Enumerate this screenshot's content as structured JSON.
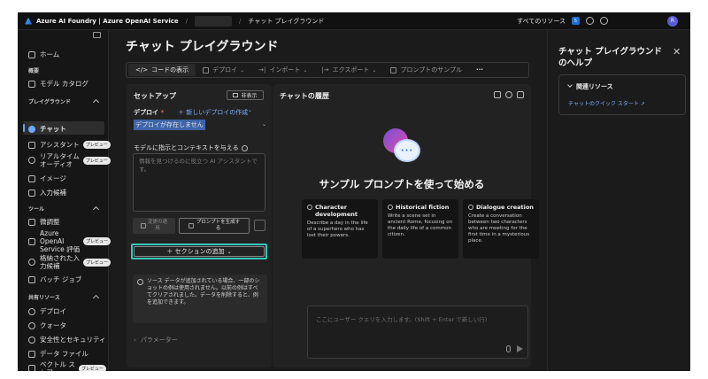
{
  "topbar": {
    "brand": "Azure AI Foundry | Azure OpenAI Service",
    "separator": "/",
    "crumb": "チャット プレイグラウンド",
    "all_resources": "すべてのリソース",
    "badge": "5",
    "avatar": "R"
  },
  "sidebar": {
    "home": "ホーム",
    "overview_head": "概要",
    "model_catalog": "モデル カタログ",
    "playground_head": "プレイグラウンド",
    "chat": "チャット",
    "assistant": "アシスタント",
    "realtime_audio_1": "リアルタイム",
    "realtime_audio_2": "オーディオ",
    "image": "イメージ",
    "completions": "入力候補",
    "tools_head": "ツール",
    "finetune": "微調整",
    "eval_1": "Azure",
    "eval_2": "OpenAI",
    "eval_3": "Service 評価",
    "stored_1": "格納された入",
    "stored_2": "力候補",
    "batch": "バッチ ジョブ",
    "shared_head": "共有リソース",
    "deployments": "デプロイ",
    "quota": "クォータ",
    "safety": "安全性とセキュリティ",
    "data_files": "データ ファイル",
    "vector_1": "ベクトル ス",
    "vector_2": "トア",
    "preview_label": "プレビュー"
  },
  "main": {
    "title": "チャット プレイグラウンド",
    "toolbar": {
      "view_code": "コードの表示",
      "deploy": "デプロイ",
      "import": "インポート",
      "export": "エクスポート",
      "samples": "プロンプトのサンプル",
      "more": "···"
    }
  },
  "setup": {
    "title": "セットアップ",
    "hide": "非表示",
    "deploy_label": "デプロイ",
    "required_mark": "*",
    "new_deploy": "＋ 新しいデプロイの作成",
    "deploy_value": "デプロイが存在しません",
    "instructions_label": "モデルに指示とコンテキストを与える",
    "instructions_placeholder": "情報を見つけるのに役立つ AI アシスタントです。",
    "apply_changes_1": "変更の適",
    "apply_changes_2": "用",
    "generate_prompt_1": "プロンプトを生成す",
    "generate_prompt_2": "る",
    "add_section": "＋ セクションの追加",
    "note": "ソース データが追加されている場合、一部のショットの例は使用されません。以前の例はすべてクリアされました。データを削除すると、例を追加できます。",
    "parameters": "パラメーター"
  },
  "chat": {
    "title": "チャットの履歴",
    "heading": "サンプル プロンプトを使って始める",
    "cards": [
      {
        "title": "Character development",
        "desc": "Describe a day in the life of a superhero who has lost their powers."
      },
      {
        "title": "Historical fiction",
        "desc": "Write a scene set in ancient Rome, focusing on the daily life of a common citizen."
      },
      {
        "title": "Dialogue creation",
        "desc": "Create a conversation between two characters who are meeting for the first time in a mysterious place."
      }
    ],
    "input_placeholder": "ここにユーザー クエリを入力します。(Shift + Enter で新しい行)"
  },
  "help": {
    "title": "チャット プレイグラウンドのヘルプ",
    "related": "関連リソース",
    "quickstart": "チャットのクイック スタート"
  }
}
